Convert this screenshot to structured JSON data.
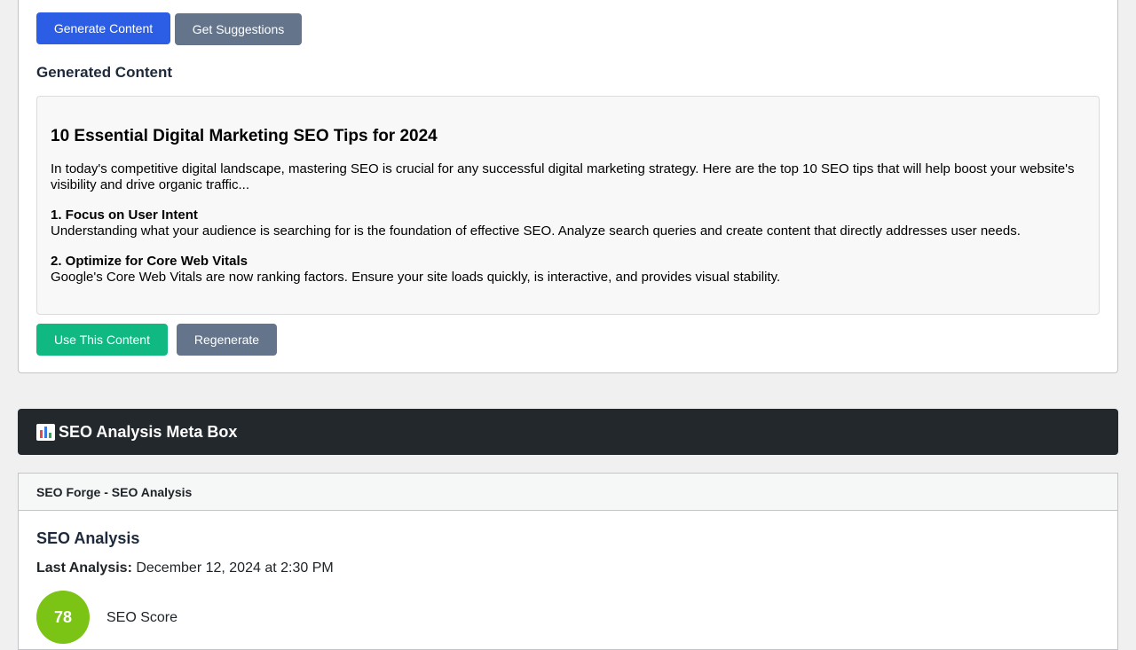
{
  "generator": {
    "generate_button": "Generate Content",
    "suggest_button": "Get Suggestions",
    "heading": "Generated Content",
    "article": {
      "title": "10 Essential Digital Marketing SEO Tips for 2024",
      "intro": "In today's competitive digital landscape, mastering SEO is crucial for any successful digital marketing strategy. Here are the top 10 SEO tips that will help boost your website's visibility and drive organic traffic...",
      "tips": [
        {
          "heading": "1. Focus on User Intent",
          "body": "Understanding what your audience is searching for is the foundation of effective SEO. Analyze search queries and create content that directly addresses user needs."
        },
        {
          "heading": "2. Optimize for Core Web Vitals",
          "body": "Google's Core Web Vitals are now ranking factors. Ensure your site loads quickly, is interactive, and provides visual stability."
        }
      ]
    },
    "use_button": "Use This Content",
    "regenerate_button": "Regenerate"
  },
  "meta_header": {
    "icon": "bar-chart-icon",
    "title": "SEO Analysis Meta Box"
  },
  "meta_box": {
    "header": "SEO Forge - SEO Analysis",
    "title": "SEO Analysis",
    "last_analysis_label": "Last Analysis:",
    "last_analysis_value": "December 12, 2024 at 2:30 PM",
    "score": "78",
    "score_label": "SEO Score",
    "score_color": "#7bc314"
  },
  "colors": {
    "primary": "#2c5ee5",
    "secondary": "#64748b",
    "success": "#10b981",
    "dark_header": "#23282d"
  }
}
